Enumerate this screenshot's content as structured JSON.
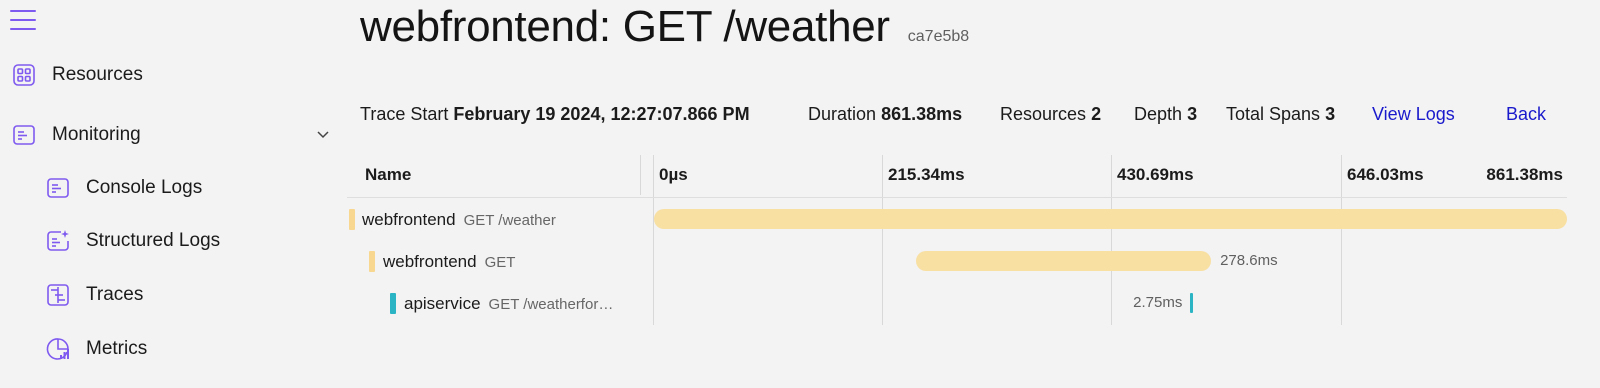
{
  "sidebar": {
    "items": [
      {
        "label": "Resources",
        "icon": "grid-icon"
      },
      {
        "label": "Monitoring",
        "icon": "monitor-icon"
      },
      {
        "label": "Console Logs",
        "icon": "console-logs-icon"
      },
      {
        "label": "Structured Logs",
        "icon": "structured-logs-icon"
      },
      {
        "label": "Traces",
        "icon": "traces-icon"
      },
      {
        "label": "Metrics",
        "icon": "metrics-icon"
      }
    ],
    "accent": "#7f5af0"
  },
  "header": {
    "title": "webfrontend: GET /weather",
    "trace_id": "ca7e5b8"
  },
  "summary": {
    "trace_start_label": "Trace Start",
    "trace_start_value": "February 19 2024, 12:27:07.866 PM",
    "duration_label": "Duration",
    "duration_value": "861.38ms",
    "resources_label": "Resources",
    "resources_value": "2",
    "depth_label": "Depth",
    "depth_value": "3",
    "total_spans_label": "Total Spans",
    "total_spans_value": "3",
    "view_logs": "View Logs",
    "back": "Back"
  },
  "grid": {
    "name_header": "Name",
    "ticks": [
      "0µs",
      "215.34ms",
      "430.69ms",
      "646.03ms",
      "861.38ms"
    ],
    "total_ms": 861.38,
    "rows": [
      {
        "service": "webfrontend",
        "operation": "GET /weather",
        "start_ms": 0,
        "duration_ms": 861.38,
        "duration_label": "",
        "color": "#f8dfa2",
        "marker": "#f8d890"
      },
      {
        "service": "webfrontend",
        "operation": "GET",
        "start_ms": 247.0,
        "duration_ms": 278.6,
        "duration_label": "278.6ms",
        "color": "#f8dfa2",
        "marker": "#f8d890"
      },
      {
        "service": "apiservice",
        "operation": "GET /weatherfor…",
        "start_ms": 506.0,
        "duration_ms": 2.75,
        "duration_label": "2.75ms",
        "color": "#2bb5c4",
        "marker": "#2bb5c4"
      }
    ]
  }
}
